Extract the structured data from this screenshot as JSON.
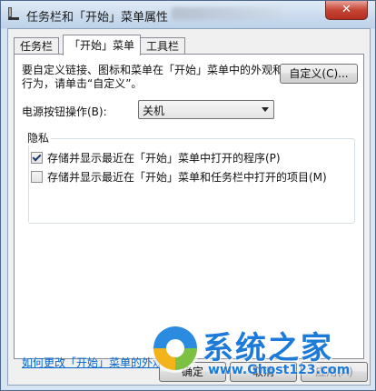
{
  "window": {
    "title": "任务栏和「开始」菜单属性",
    "close_glyph": "✕"
  },
  "tabs": [
    {
      "label": "任务栏"
    },
    {
      "label": "「开始」菜单"
    },
    {
      "label": "工具栏"
    }
  ],
  "start_menu": {
    "description": "要自定义链接、图标和菜单在「开始」菜单中的外观和行为，请单击“自定义”。",
    "customize_label": "自定义(C)...",
    "power_label": "电源按钮操作(B):",
    "power_value": "关机",
    "privacy_title": "隐私",
    "privacy_items": [
      {
        "label": "存储并显示最近在「开始」菜单中打开的程序(P)",
        "checked": true
      },
      {
        "label": "存储并显示最近在「开始」菜单和任务栏中打开的项目(M)",
        "checked": false
      }
    ],
    "help_link": "如何更改「开始」菜单的外观?"
  },
  "footer": {
    "ok_label": "确定",
    "cancel_label": "取消",
    "apply_label": "应用(A)"
  },
  "watermark": {
    "text": "系统之家",
    "url": "www.Ghost123.com"
  }
}
